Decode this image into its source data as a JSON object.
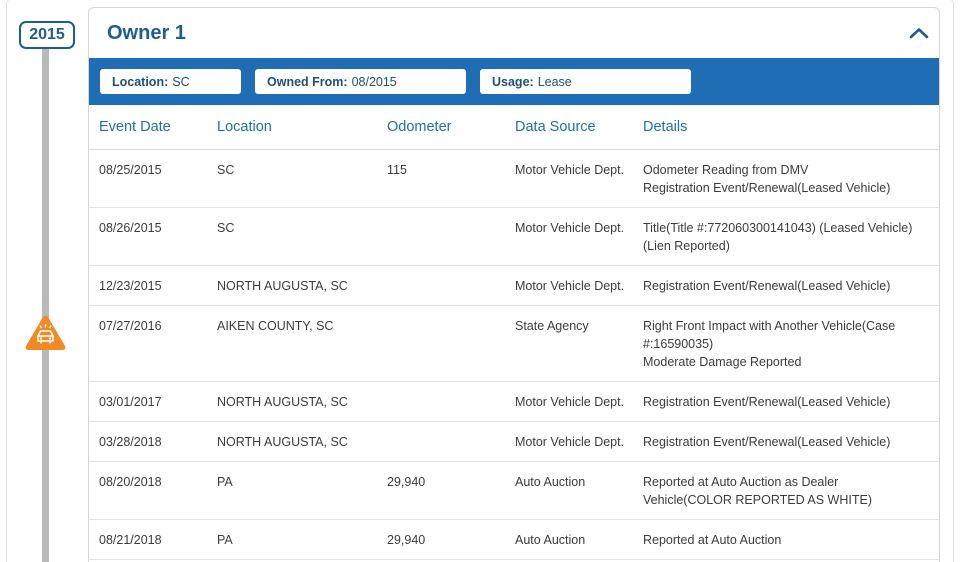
{
  "timeline": {
    "year": "2015"
  },
  "owner": {
    "title": "Owner 1"
  },
  "info_bar": {
    "location_label": "Location:",
    "location_value": "SC",
    "owned_label": "Owned From:",
    "owned_value": "08/2015",
    "usage_label": "Usage:",
    "usage_value": "Lease"
  },
  "table": {
    "headers": [
      "Event Date",
      "Location",
      "Odometer",
      "Data Source",
      "Details"
    ],
    "rows": [
      {
        "date": "08/25/2015",
        "location": "SC",
        "odometer": "115",
        "source": "Motor Vehicle Dept.",
        "details": [
          "Odometer Reading from DMV",
          "Registration Event/Renewal(Leased Vehicle)"
        ]
      },
      {
        "date": "08/26/2015",
        "location": "SC",
        "odometer": "",
        "source": "Motor Vehicle Dept.",
        "details": [
          "Title(Title #:772060300141043) (Leased Vehicle) (Lien Reported)"
        ]
      },
      {
        "date": "12/23/2015",
        "location": "NORTH AUGUSTA, SC",
        "odometer": "",
        "source": "Motor Vehicle Dept.",
        "details": [
          "Registration Event/Renewal(Leased Vehicle)"
        ]
      },
      {
        "date": "07/27/2016",
        "location": "AIKEN COUNTY, SC",
        "odometer": "",
        "source": "State Agency",
        "details": [
          "Right Front Impact with Another Vehicle(Case #:16590035)",
          "Moderate Damage Reported"
        ]
      },
      {
        "date": "03/01/2017",
        "location": "NORTH AUGUSTA, SC",
        "odometer": "",
        "source": "Motor Vehicle Dept.",
        "details": [
          "Registration Event/Renewal(Leased Vehicle)"
        ]
      },
      {
        "date": "03/28/2018",
        "location": "NORTH AUGUSTA, SC",
        "odometer": "",
        "source": "Motor Vehicle Dept.",
        "details": [
          "Registration Event/Renewal(Leased Vehicle)"
        ]
      },
      {
        "date": "08/20/2018",
        "location": "PA",
        "odometer": "29,940",
        "source": "Auto Auction",
        "details": [
          "Reported at Auto Auction as Dealer Vehicle(COLOR REPORTED AS WHITE)"
        ]
      },
      {
        "date": "08/21/2018",
        "location": "PA",
        "odometer": "29,940",
        "source": "Auto Auction",
        "details": [
          "Reported at Auto Auction"
        ]
      }
    ]
  },
  "icons": {
    "collapse": "chevron-up-icon",
    "accident": "accident-warning-icon",
    "accident_color": "#f08a24",
    "accent_color": "#1f6db5"
  }
}
